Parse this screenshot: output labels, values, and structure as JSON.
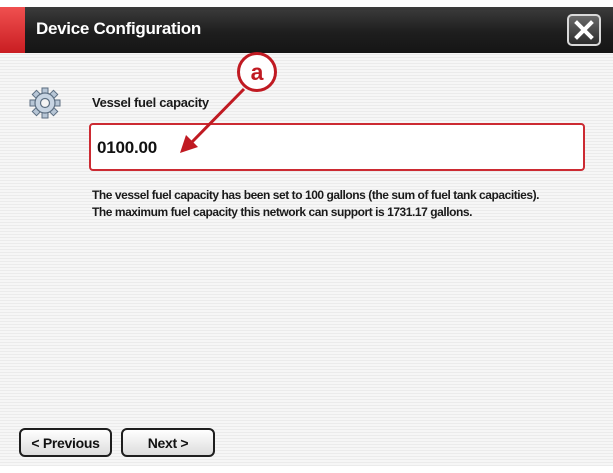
{
  "dialog": {
    "title": "Device Configuration",
    "close_label": "close"
  },
  "icons": {
    "settings": "gear-icon",
    "close": "close-icon"
  },
  "field": {
    "label": "Vessel fuel capacity",
    "value": "0100.00"
  },
  "description": {
    "line1": "The vessel fuel capacity has been set to  100 gallons (the sum of fuel tank capacities).",
    "line2": "The maximum fuel capacity this network can support is 1731.17 gallons."
  },
  "buttons": {
    "previous": "< Previous",
    "next": "Next >"
  },
  "annotation": {
    "label": "a",
    "color": "#c01a22"
  },
  "colors": {
    "accent": "#cc2a32",
    "titlebar": "#1e1e1e"
  }
}
